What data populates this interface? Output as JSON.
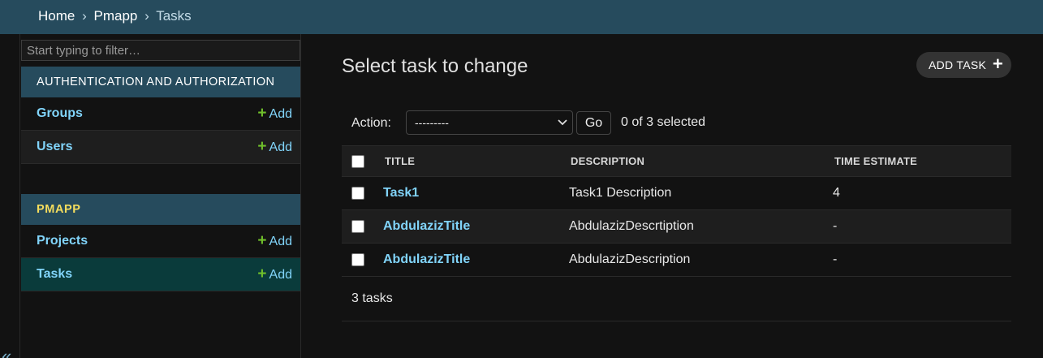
{
  "breadcrumbs": {
    "home": "Home",
    "sep1": "›",
    "app": "Pmapp",
    "sep2": "›",
    "current": "Tasks"
  },
  "sidebar": {
    "filter_placeholder": "Start typing to filter…",
    "collapse_glyph": "«",
    "apps": [
      {
        "name": "AUTHENTICATION AND AUTHORIZATION",
        "models": [
          {
            "name": "Groups",
            "add_label": "Add"
          },
          {
            "name": "Users",
            "add_label": "Add"
          }
        ]
      },
      {
        "name": "PMAPP",
        "models": [
          {
            "name": "Projects",
            "add_label": "Add"
          },
          {
            "name": "Tasks",
            "add_label": "Add",
            "active": true
          }
        ]
      }
    ]
  },
  "main": {
    "title": "Select task to change",
    "add_button": "ADD TASK",
    "action": {
      "label": "Action:",
      "selected": "---------",
      "go_label": "Go",
      "selection_status": "0 of 3 selected"
    },
    "table": {
      "columns": [
        "TITLE",
        "DESCRIPTION",
        "TIME ESTIMATE"
      ],
      "rows": [
        {
          "title": "Task1",
          "description": "Task1 Description",
          "time_estimate": "4"
        },
        {
          "title": "AbdulazizTitle",
          "description": "AbdulazizDescrtiption",
          "time_estimate": "-"
        },
        {
          "title": "AbdulazizTitle",
          "description": "AbdulazizDescription",
          "time_estimate": "-"
        }
      ]
    },
    "result_count": "3 tasks"
  },
  "colors": {
    "header_bg": "#264b5d",
    "link": "#81d4fa",
    "add_plus": "#70bf2b",
    "module_title": "#f5dd5d",
    "active_row": "#0a3b3b"
  }
}
